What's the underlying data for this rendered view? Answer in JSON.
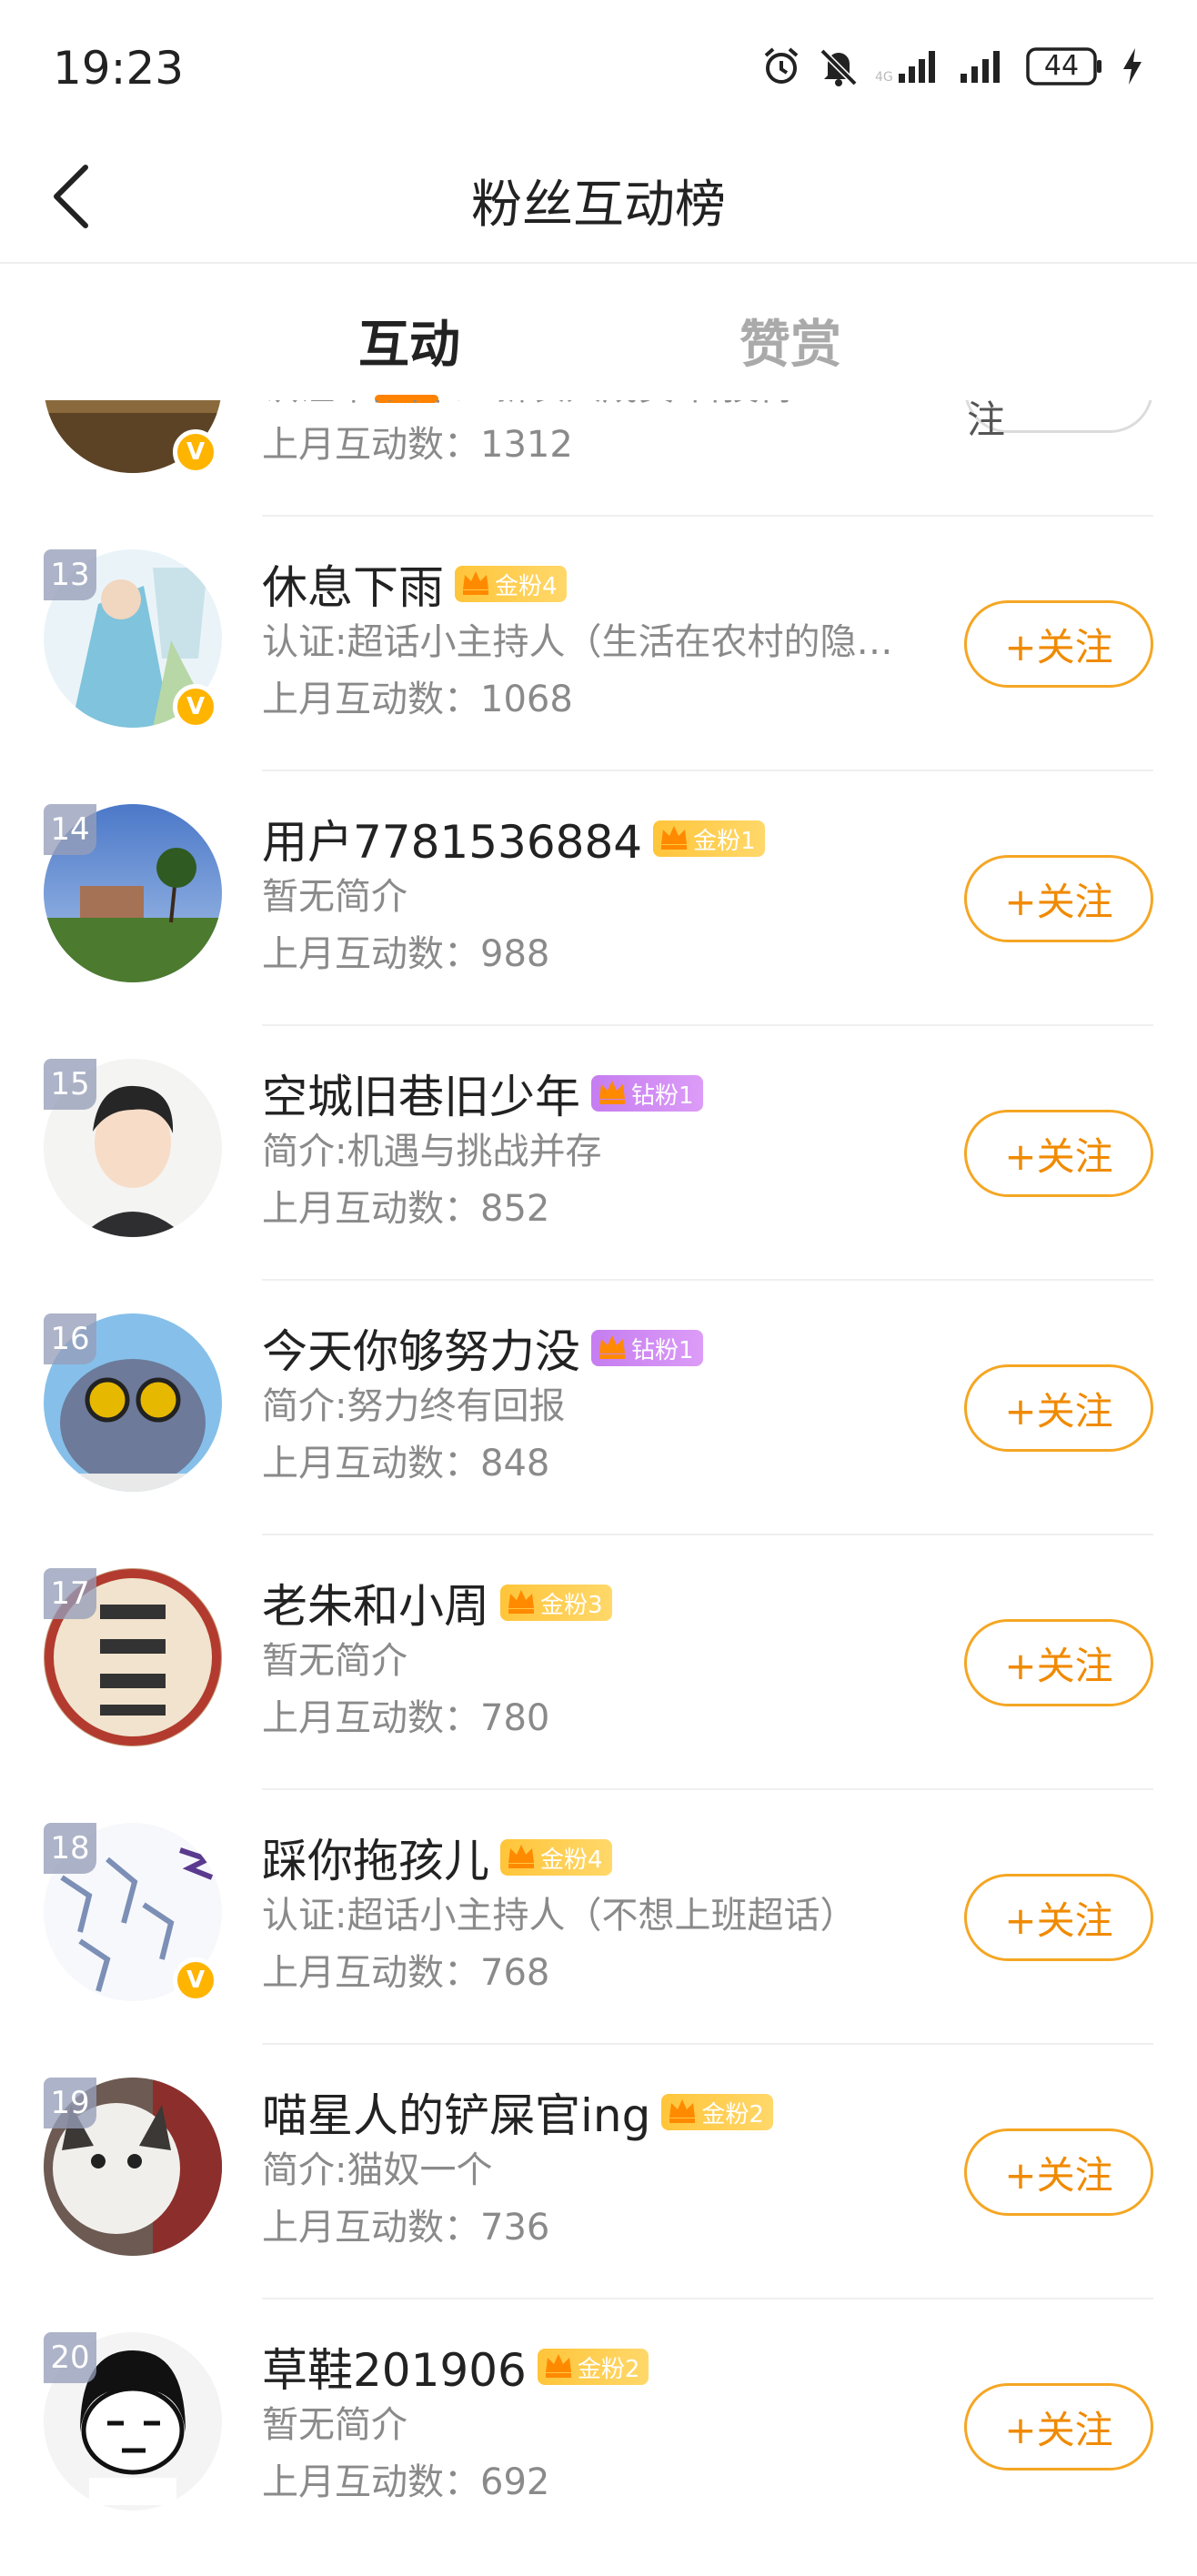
{
  "status_bar": {
    "time": "19:23",
    "battery": "44",
    "icons": [
      "alarm-icon",
      "mute-icon",
      "signal-icon",
      "signal-icon",
      "battery-icon",
      "charging-icon"
    ]
  },
  "header": {
    "title": "粉丝互动榜",
    "back_icon": "back-arrow-icon"
  },
  "tabs": [
    {
      "label": "互动",
      "active": true
    },
    {
      "label": "赞赏",
      "active": false
    }
  ],
  "colors": {
    "accent": "#ff8200",
    "follow_border": "#f5a623",
    "gold_badge": "#ffc53a",
    "diamond_badge": "#c57df0",
    "verified": "#ffb400"
  },
  "list": [
    {
      "rank": "",
      "name": "",
      "badge": "",
      "bio": "认证:白云平红新农人成员 科技博…",
      "count": "上月互动数：1312",
      "follow": "⇆ 互相关注",
      "verified": true
    },
    {
      "rank": "13",
      "name": "休息下雨",
      "badge": "金粉4",
      "badge_type": "gold",
      "bio": "认证:超话小主持人（生活在农村的隐…",
      "count": "上月互动数：1068",
      "follow": "+关注",
      "verified": true
    },
    {
      "rank": "14",
      "name": "用户7781536884",
      "badge": "金粉1",
      "badge_type": "gold",
      "bio": "暂无简介",
      "count": "上月互动数：988",
      "follow": "+关注",
      "verified": false
    },
    {
      "rank": "15",
      "name": "空城旧巷旧少年",
      "badge": "钻粉1",
      "badge_type": "diamond",
      "bio": "简介:机遇与挑战并存",
      "count": "上月互动数：852",
      "follow": "+关注",
      "verified": false
    },
    {
      "rank": "16",
      "name": "今天你够努力没",
      "badge": "钻粉1",
      "badge_type": "diamond",
      "bio": "简介:努力终有回报",
      "count": "上月互动数：848",
      "follow": "+关注",
      "verified": false
    },
    {
      "rank": "17",
      "name": "老朱和小周",
      "badge": "金粉3",
      "badge_type": "gold",
      "bio": "暂无简介",
      "count": "上月互动数：780",
      "follow": "+关注",
      "verified": false
    },
    {
      "rank": "18",
      "name": "踩你拖孩儿",
      "badge": "金粉4",
      "badge_type": "gold",
      "bio": "认证:超话小主持人（不想上班超话）",
      "count": "上月互动数：768",
      "follow": "+关注",
      "verified": true
    },
    {
      "rank": "19",
      "name": "喵星人的铲屎官ing",
      "badge": "金粉2",
      "badge_type": "gold",
      "bio": "简介:猫奴一个",
      "count": "上月互动数：736",
      "follow": "+关注",
      "verified": false
    },
    {
      "rank": "20",
      "name": "草鞋201906",
      "badge": "金粉2",
      "badge_type": "gold",
      "bio": "暂无简介",
      "count": "上月互动数：692",
      "follow": "+关注",
      "verified": false
    }
  ]
}
